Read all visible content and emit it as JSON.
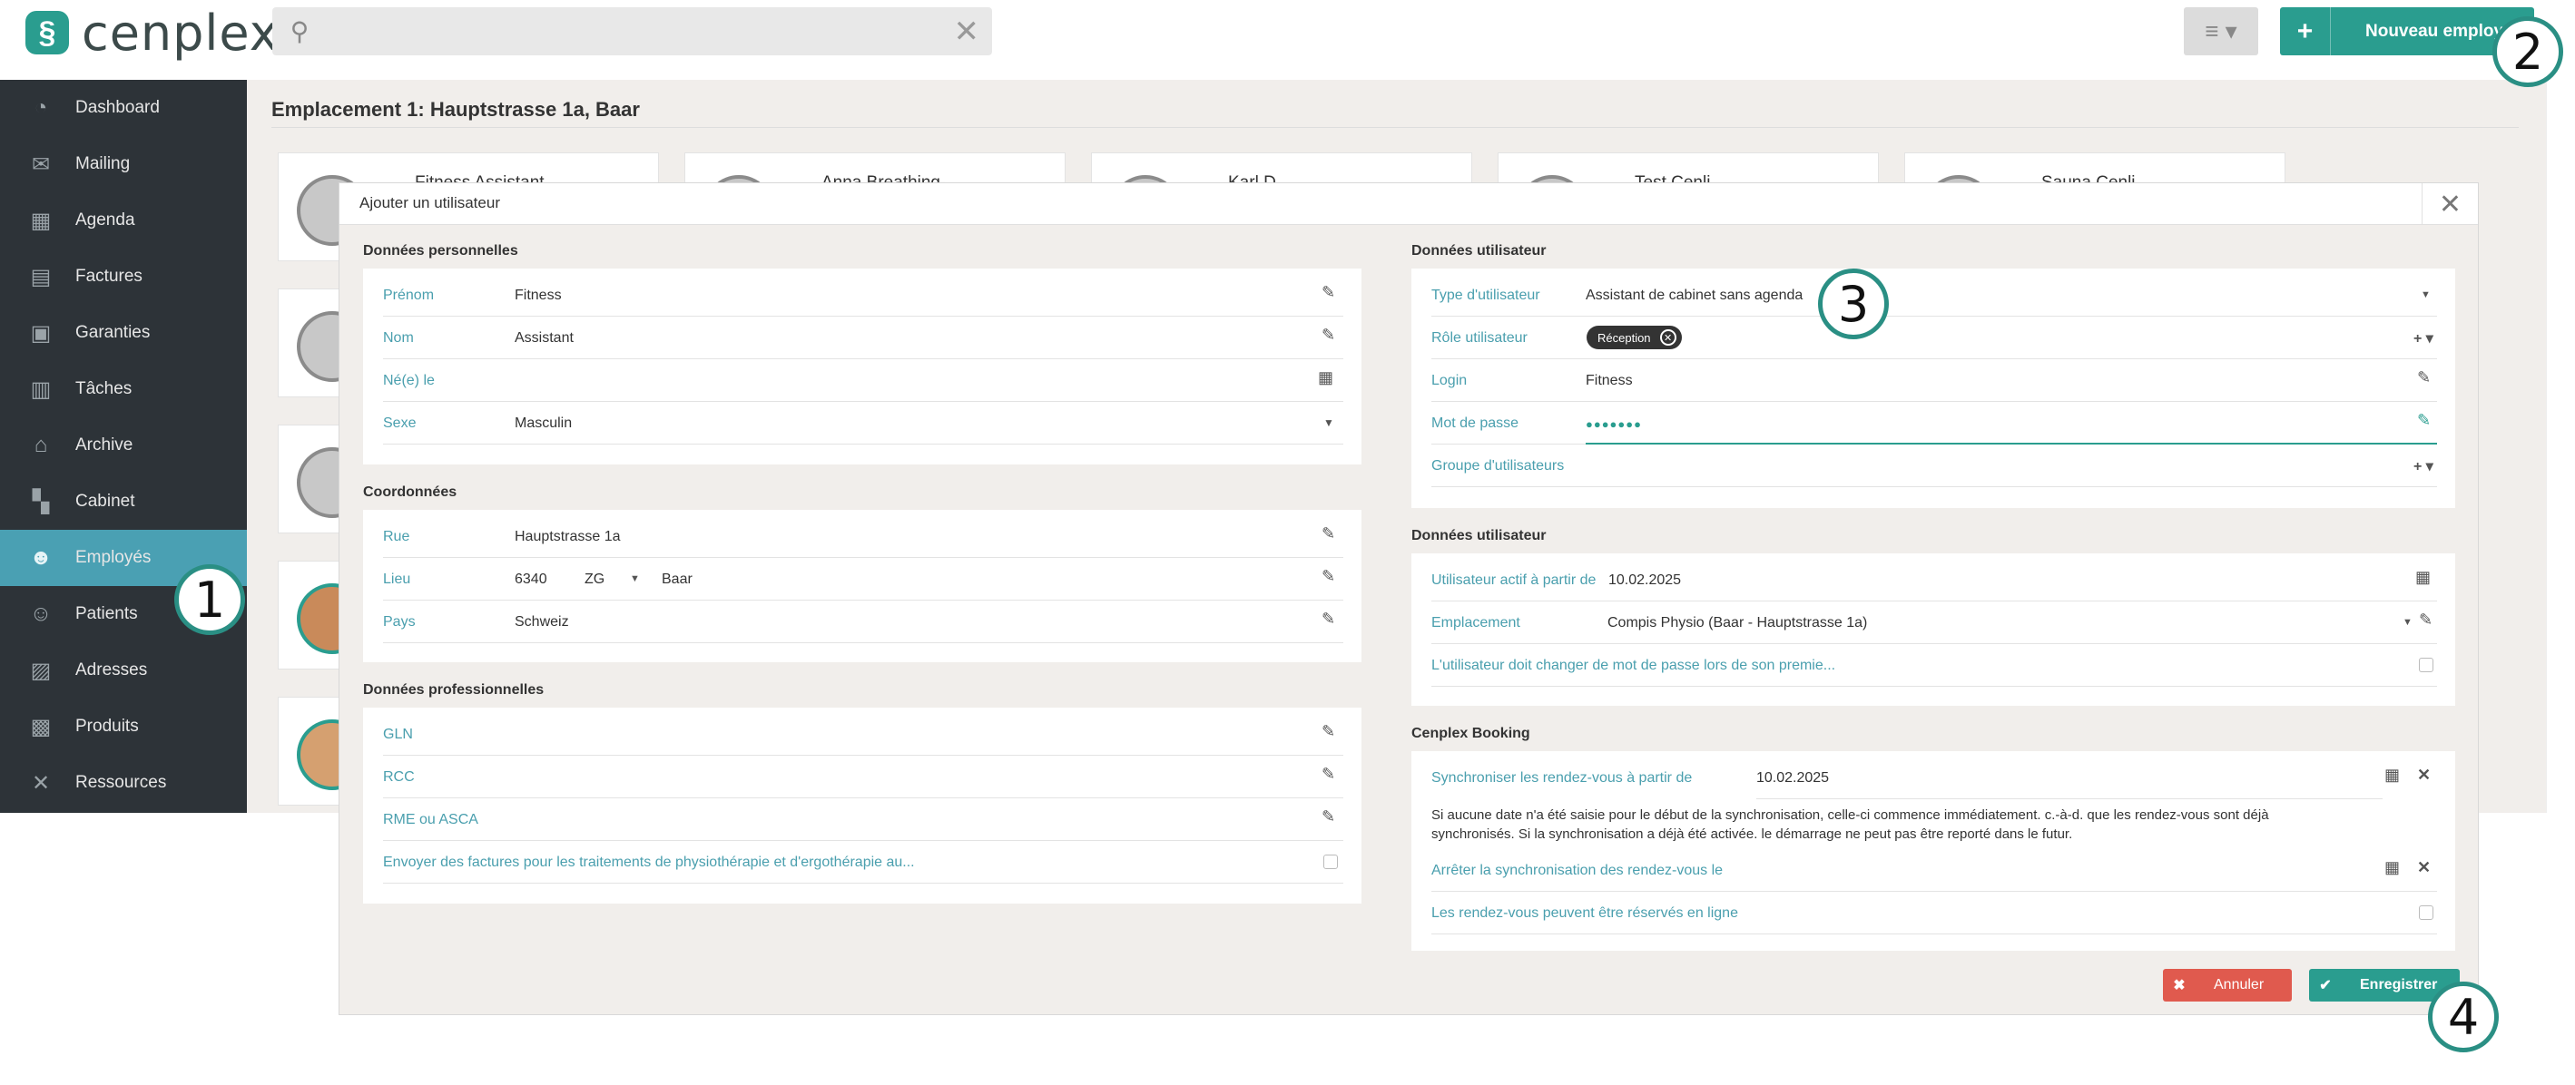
{
  "brand": {
    "name": "cenplex"
  },
  "search": {
    "placeholder": ""
  },
  "header": {
    "new_employee_label": "Nouveau employé"
  },
  "sidebar": {
    "items": [
      {
        "label": "Dashboard",
        "icon": "dashboard-icon"
      },
      {
        "label": "Mailing",
        "icon": "mail-icon"
      },
      {
        "label": "Agenda",
        "icon": "calendar-icon"
      },
      {
        "label": "Factures",
        "icon": "calculator-icon"
      },
      {
        "label": "Garanties",
        "icon": "guarantee-icon"
      },
      {
        "label": "Tâches",
        "icon": "clipboard-icon"
      },
      {
        "label": "Archive",
        "icon": "archive-icon"
      },
      {
        "label": "Cabinet",
        "icon": "building-icon"
      },
      {
        "label": "Employés",
        "icon": "employees-icon",
        "active": true
      },
      {
        "label": "Patients",
        "icon": "patients-icon"
      },
      {
        "label": "Adresses",
        "icon": "addressbook-icon"
      },
      {
        "label": "Produits",
        "icon": "store-icon"
      },
      {
        "label": "Ressources",
        "icon": "tools-icon"
      }
    ]
  },
  "page": {
    "title": "Emplacement 1: Hauptstrasse 1a, Baar"
  },
  "cards": [
    {
      "name": "Fitness Assistant"
    },
    {
      "name": "Anna Breathing-..."
    },
    {
      "name": "Karl D..."
    },
    {
      "name": "Test Cenli..."
    },
    {
      "name": "Sauna Cenli..."
    }
  ],
  "modal": {
    "title": "Ajouter un utilisateur",
    "personal": {
      "title": "Données personnelles",
      "first_name_label": "Prénom",
      "first_name": "Fitness",
      "last_name_label": "Nom",
      "last_name": "Assistant",
      "birth_label": "Né(e) le",
      "birth": "",
      "sex_label": "Sexe",
      "sex": "Masculin"
    },
    "contact": {
      "title": "Coordonnées",
      "street_label": "Rue",
      "street": "Hauptstrasse 1a",
      "place_label": "Lieu",
      "zip": "6340",
      "canton": "ZG",
      "city": "Baar",
      "country_label": "Pays",
      "country": "Schweiz"
    },
    "professional": {
      "title": "Données professionnelles",
      "gln_label": "GLN",
      "rcc_label": "RCC",
      "rme_label": "RME ou ASCA",
      "invoice_label": "Envoyer des factures pour les traitements de physiothérapie et d'ergothérapie au..."
    },
    "user": {
      "title": "Données utilisateur",
      "type_label": "Type d'utilisateur",
      "type": "Assistant de cabinet sans agenda",
      "role_label": "Rôle utilisateur",
      "role_chip": "Réception",
      "login_label": "Login",
      "login": "Fitness",
      "password_label": "Mot de passe",
      "password": "●●●●●●●",
      "group_label": "Groupe d'utilisateurs"
    },
    "user2": {
      "title": "Données utilisateur",
      "active_label": "Utilisateur actif à partir de",
      "active": "10.02.2025",
      "location_label": "Emplacement",
      "location": "Compis Physio (Baar - Hauptstrasse 1a)",
      "change_pw_label": "L'utilisateur doit changer de mot de passe lors de son premie..."
    },
    "booking": {
      "title": "Cenplex Booking",
      "sync_label": "Synchroniser les rendez-vous à partir de",
      "sync": "10.02.2025",
      "info_line1": "Si aucune date n'a été saisie pour le début de la synchronisation, celle-ci commence immédiatement. c.-à-d. que les rendez-vous sont déjà",
      "info_line2": "synchronisés. Si la synchronisation a déjà été activée. le démarrage ne peut pas être reporté dans le futur.",
      "stop_label": "Arrêter la synchronisation des rendez-vous le",
      "online_label": "Les rendez-vous peuvent être réservés en ligne"
    },
    "cancel_label": "Annuler",
    "save_label": "Enregistrer"
  },
  "callouts": [
    "1",
    "2",
    "3",
    "4"
  ],
  "colors": {
    "accent": "#2a9d8f",
    "sidebar": "#2d3338",
    "active_nav": "#4aa0b3",
    "cancel": "#e05a4e"
  }
}
